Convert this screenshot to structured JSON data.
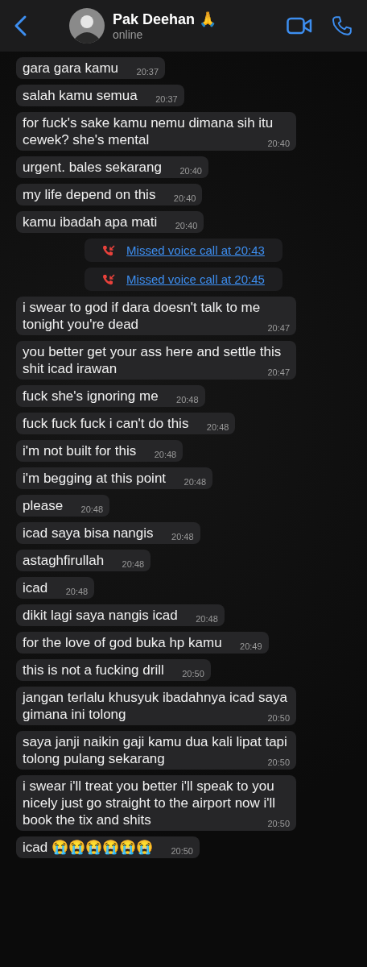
{
  "header": {
    "name": "Pak Deehan 🙏",
    "status": "online"
  },
  "messages": [
    {
      "kind": "message",
      "text": "gara gara kamu",
      "time": "20:37"
    },
    {
      "kind": "message",
      "text": "salah kamu semua",
      "time": "20:37"
    },
    {
      "kind": "message",
      "text": "for fuck's sake kamu nemu dimana sih itu cewek? she's mental",
      "time": "20:40"
    },
    {
      "kind": "message",
      "text": "urgent. bales sekarang",
      "time": "20:40"
    },
    {
      "kind": "message",
      "text": "my life depend on this",
      "time": "20:40"
    },
    {
      "kind": "message",
      "text": "kamu ibadah apa mati",
      "time": "20:40"
    },
    {
      "kind": "missed_call",
      "text": "Missed voice call at 20:43"
    },
    {
      "kind": "missed_call",
      "text": "Missed voice call at 20:45"
    },
    {
      "kind": "message",
      "text": "i swear to god if dara doesn't talk to me tonight you're dead",
      "time": "20:47"
    },
    {
      "kind": "message",
      "text": "you better get your ass here and settle this shit icad irawan",
      "time": "20:47"
    },
    {
      "kind": "message",
      "text": "fuck she's ignoring me",
      "time": "20:48"
    },
    {
      "kind": "message",
      "text": "fuck fuck fuck i can't do this",
      "time": "20:48"
    },
    {
      "kind": "message",
      "text": "i'm not built for this",
      "time": "20:48"
    },
    {
      "kind": "message",
      "text": "i'm begging at this point",
      "time": "20:48"
    },
    {
      "kind": "message",
      "text": "please",
      "time": "20:48"
    },
    {
      "kind": "message",
      "text": "icad saya bisa nangis",
      "time": "20:48"
    },
    {
      "kind": "message",
      "text": "astaghfirullah",
      "time": "20:48"
    },
    {
      "kind": "message",
      "text": "icad",
      "time": "20:48"
    },
    {
      "kind": "message",
      "text": "dikit lagi saya nangis icad",
      "time": "20:48"
    },
    {
      "kind": "message",
      "text": "for the love of god buka hp kamu",
      "time": "20:49"
    },
    {
      "kind": "message",
      "text": "this is not a fucking drill",
      "time": "20:50"
    },
    {
      "kind": "message",
      "text": "jangan terlalu khusyuk ibadahnya icad saya gimana ini tolong",
      "time": "20:50"
    },
    {
      "kind": "message",
      "text": "saya janji naikin gaji kamu dua kali lipat tapi tolong pulang sekarang",
      "time": "20:50"
    },
    {
      "kind": "message",
      "text": "i swear i'll treat you better i'll speak to you nicely just go straight to the airport now i'll book the tix and shits",
      "time": "20:50"
    },
    {
      "kind": "message",
      "text": "icad 😭😭😭😭😭😭",
      "time": "20:50"
    }
  ]
}
